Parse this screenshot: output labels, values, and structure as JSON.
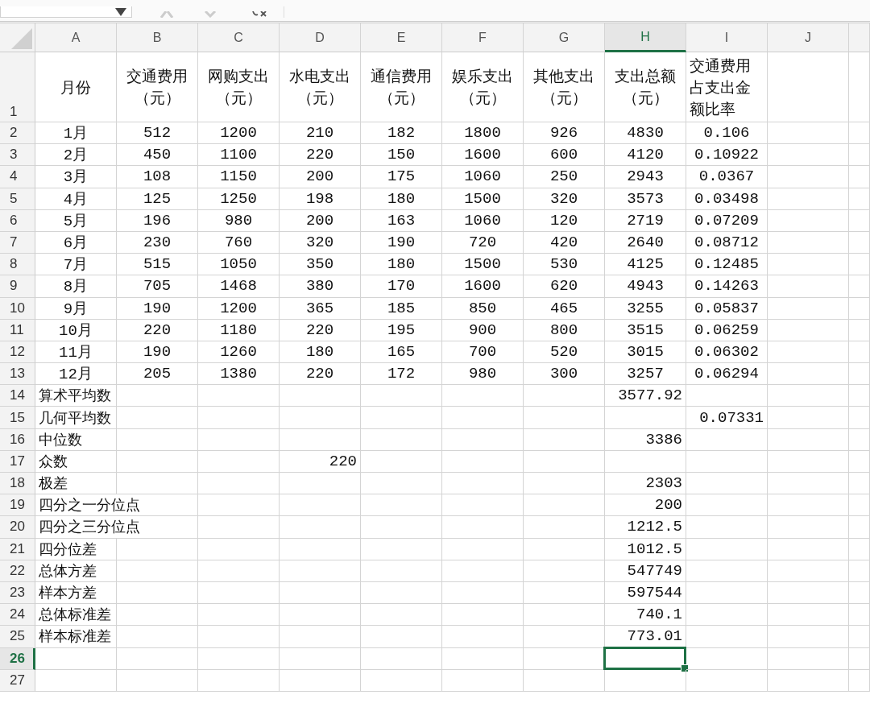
{
  "columns": [
    {
      "label": "A",
      "selected": false
    },
    {
      "label": "B",
      "selected": false
    },
    {
      "label": "C",
      "selected": false
    },
    {
      "label": "D",
      "selected": false
    },
    {
      "label": "E",
      "selected": false
    },
    {
      "label": "F",
      "selected": false
    },
    {
      "label": "G",
      "selected": false
    },
    {
      "label": "H",
      "selected": true
    },
    {
      "label": "I",
      "selected": false
    },
    {
      "label": "J",
      "selected": false
    }
  ],
  "rows": [
    {
      "number": "1",
      "kind": "header",
      "selected": false,
      "A": "月份",
      "B": "交通费用（元）",
      "C": "网购支出（元）",
      "D": "水电支出（元）",
      "E": "通信费用（元）",
      "F": "娱乐支出（元）",
      "G": "其他支出（元）",
      "H": "支出总额（元）",
      "I": "交通费用占支出金额比率"
    },
    {
      "number": "2",
      "kind": "data",
      "selected": false,
      "A": "1月",
      "B": "512",
      "C": "1200",
      "D": "210",
      "E": "182",
      "F": "1800",
      "G": "926",
      "H": "4830",
      "I": "0.106"
    },
    {
      "number": "3",
      "kind": "data",
      "selected": false,
      "A": "2月",
      "B": "450",
      "C": "1100",
      "D": "220",
      "E": "150",
      "F": "1600",
      "G": "600",
      "H": "4120",
      "I": "0.10922"
    },
    {
      "number": "4",
      "kind": "data",
      "selected": false,
      "A": "3月",
      "B": "108",
      "C": "1150",
      "D": "200",
      "E": "175",
      "F": "1060",
      "G": "250",
      "H": "2943",
      "I": "0.0367"
    },
    {
      "number": "5",
      "kind": "data",
      "selected": false,
      "A": "4月",
      "B": "125",
      "C": "1250",
      "D": "198",
      "E": "180",
      "F": "1500",
      "G": "320",
      "H": "3573",
      "I": "0.03498"
    },
    {
      "number": "6",
      "kind": "data",
      "selected": false,
      "A": "5月",
      "B": "196",
      "C": "980",
      "D": "200",
      "E": "163",
      "F": "1060",
      "G": "120",
      "H": "2719",
      "I": "0.07209"
    },
    {
      "number": "7",
      "kind": "data",
      "selected": false,
      "A": "6月",
      "B": "230",
      "C": "760",
      "D": "320",
      "E": "190",
      "F": "720",
      "G": "420",
      "H": "2640",
      "I": "0.08712"
    },
    {
      "number": "8",
      "kind": "data",
      "selected": false,
      "A": "7月",
      "B": "515",
      "C": "1050",
      "D": "350",
      "E": "180",
      "F": "1500",
      "G": "530",
      "H": "4125",
      "I": "0.12485"
    },
    {
      "number": "9",
      "kind": "data",
      "selected": false,
      "A": "8月",
      "B": "705",
      "C": "1468",
      "D": "380",
      "E": "170",
      "F": "1600",
      "G": "620",
      "H": "4943",
      "I": "0.14263"
    },
    {
      "number": "10",
      "kind": "data",
      "selected": false,
      "A": "9月",
      "B": "190",
      "C": "1200",
      "D": "365",
      "E": "185",
      "F": "850",
      "G": "465",
      "H": "3255",
      "I": "0.05837"
    },
    {
      "number": "11",
      "kind": "data",
      "selected": false,
      "A": "10月",
      "B": "220",
      "C": "1180",
      "D": "220",
      "E": "195",
      "F": "900",
      "G": "800",
      "H": "3515",
      "I": "0.06259"
    },
    {
      "number": "12",
      "kind": "data",
      "selected": false,
      "A": "11月",
      "B": "190",
      "C": "1260",
      "D": "180",
      "E": "165",
      "F": "700",
      "G": "520",
      "H": "3015",
      "I": "0.06302"
    },
    {
      "number": "13",
      "kind": "data",
      "selected": false,
      "A": "12月",
      "B": "205",
      "C": "1380",
      "D": "220",
      "E": "172",
      "F": "980",
      "G": "300",
      "H": "3257",
      "I": "0.06294"
    },
    {
      "number": "14",
      "kind": "stat",
      "selected": false,
      "A": "算术平均数",
      "H": "3577.92"
    },
    {
      "number": "15",
      "kind": "stat",
      "selected": false,
      "A": "几何平均数",
      "I": "0.07331"
    },
    {
      "number": "16",
      "kind": "stat",
      "selected": false,
      "A": "中位数",
      "H": "3386"
    },
    {
      "number": "17",
      "kind": "stat",
      "selected": false,
      "A": "众数",
      "D": "220"
    },
    {
      "number": "18",
      "kind": "stat",
      "selected": false,
      "A": "极差",
      "H": "2303"
    },
    {
      "number": "19",
      "kind": "stat",
      "selected": false,
      "A": "四分之一分位点",
      "H": "200"
    },
    {
      "number": "20",
      "kind": "stat",
      "selected": false,
      "A": "四分之三分位点",
      "H": "1212.5"
    },
    {
      "number": "21",
      "kind": "stat",
      "selected": false,
      "A": "四分位差",
      "H": "1012.5"
    },
    {
      "number": "22",
      "kind": "stat",
      "selected": false,
      "A": "总体方差",
      "H": "547749"
    },
    {
      "number": "23",
      "kind": "stat",
      "selected": false,
      "A": "样本方差",
      "H": "597544"
    },
    {
      "number": "24",
      "kind": "stat",
      "selected": false,
      "A": "总体标准差",
      "H": "740.1"
    },
    {
      "number": "25",
      "kind": "stat",
      "selected": false,
      "A": "样本标准差",
      "H": "773.01"
    },
    {
      "number": "26",
      "kind": "stat",
      "selected": true
    },
    {
      "number": "27",
      "kind": "stat",
      "selected": false
    }
  ]
}
